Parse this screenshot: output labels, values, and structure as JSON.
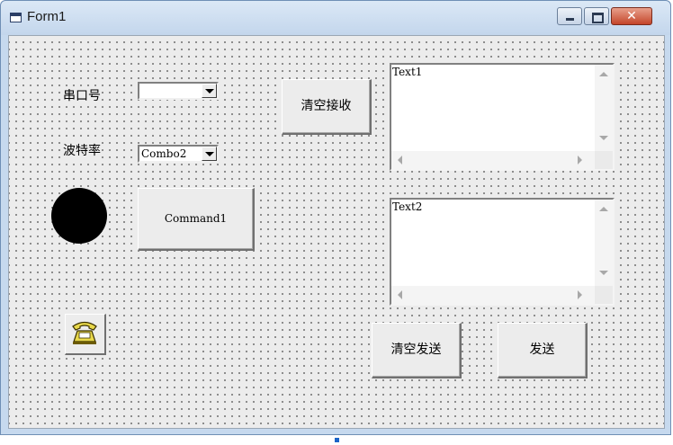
{
  "window": {
    "title": "Form1",
    "close_glyph": "✕"
  },
  "labels": {
    "port": "串口号",
    "baud": "波特率"
  },
  "combos": {
    "port": {
      "value": ""
    },
    "baud": {
      "value": "Combo2"
    }
  },
  "buttons": {
    "clear_receive": "清空接收",
    "command1": "Command1",
    "clear_send": "清空发送",
    "send": "发送"
  },
  "textboxes": {
    "text1": "Text1",
    "text2": "Text2"
  },
  "icons": {
    "window": "form-window-icon",
    "phone": "telephone-icon",
    "status_shape": "black-circle-shape"
  },
  "colors": {
    "form_background": "#ececec",
    "title_bar": "#c3d6ec",
    "close_button": "#c4452a",
    "circle": "#000000",
    "selection_handle": "#1b64c8"
  }
}
